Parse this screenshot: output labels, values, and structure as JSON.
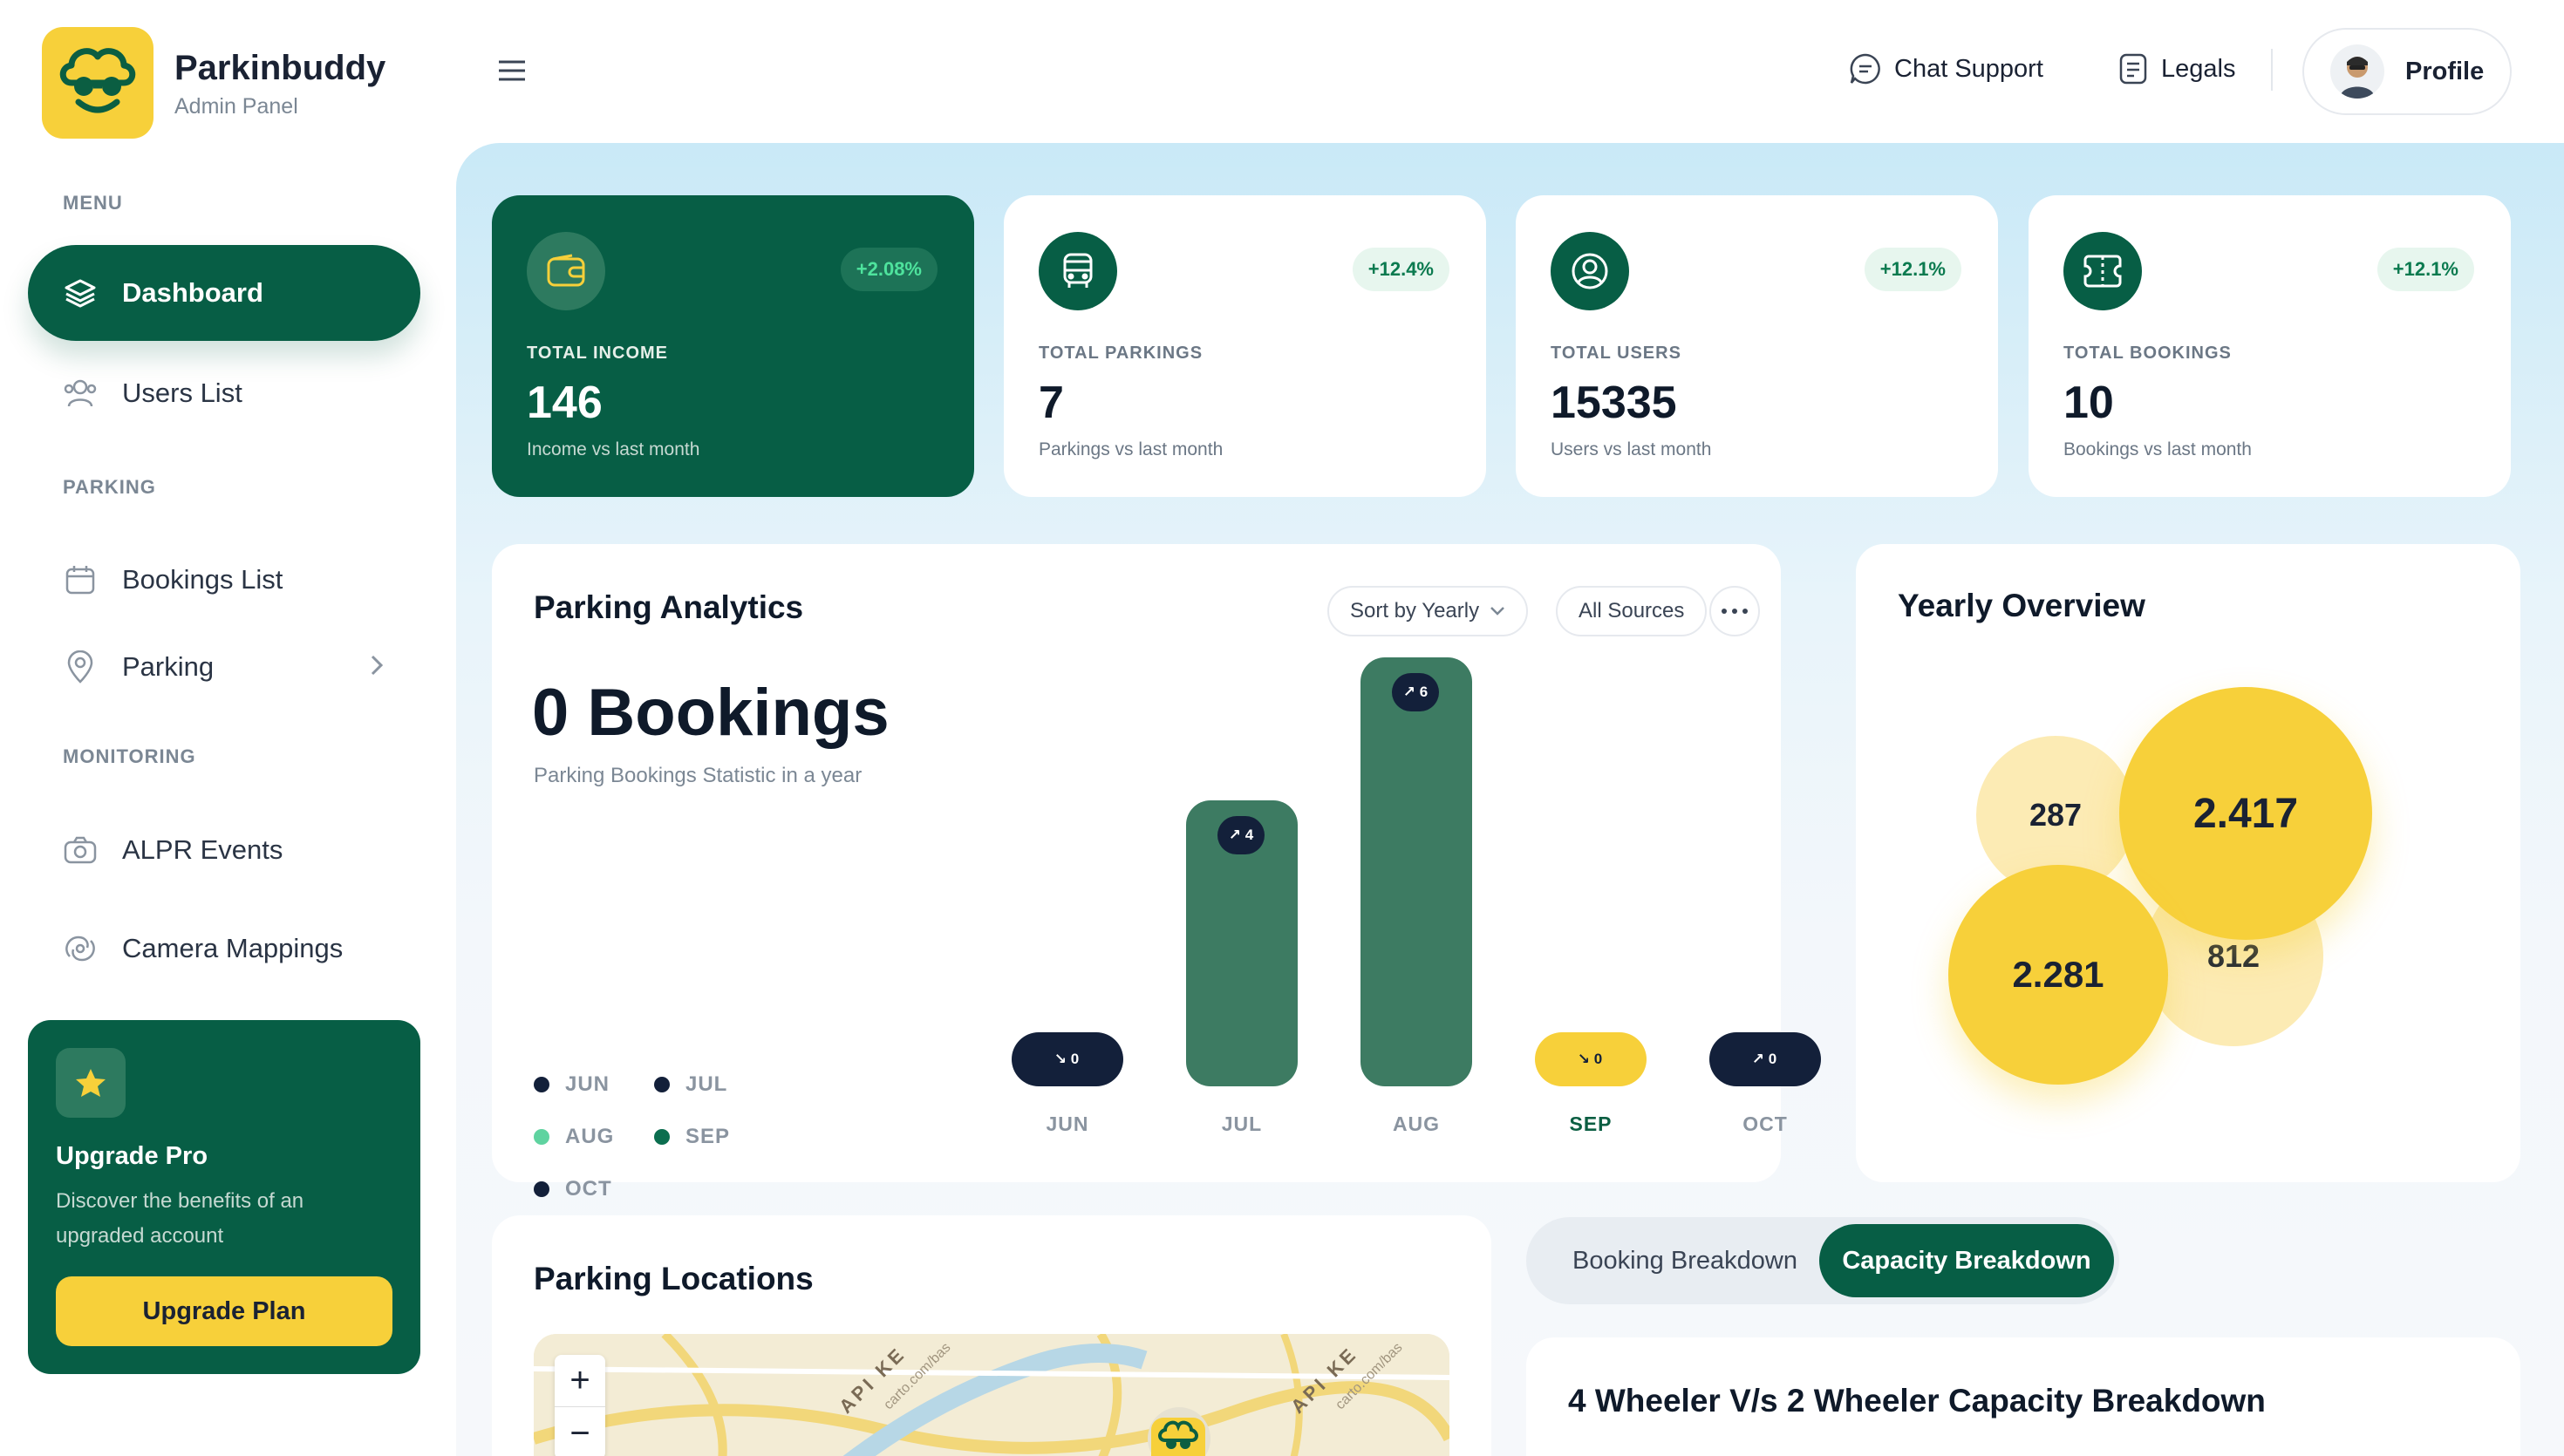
{
  "brand": {
    "name": "Parkinbuddy",
    "subtitle": "Admin Panel",
    "logo_color": "#f7d03a"
  },
  "sidebar": {
    "sections": {
      "menu": "MENU",
      "parking": "PARKING",
      "monitoring": "MONITORING"
    },
    "items": [
      {
        "label": "Dashboard",
        "icon": "layers-icon",
        "active": true
      },
      {
        "label": "Users List",
        "icon": "users-icon"
      },
      {
        "label": "Bookings List",
        "icon": "calendar-icon"
      },
      {
        "label": "Parking",
        "icon": "map-pin-icon",
        "has_submenu": true
      },
      {
        "label": "ALPR Events",
        "icon": "camera-icon"
      },
      {
        "label": "Camera Mappings",
        "icon": "camera-mapping-icon"
      }
    ],
    "upgrade": {
      "title": "Upgrade Pro",
      "description": "Discover the benefits of an upgraded account",
      "button": "Upgrade Plan"
    }
  },
  "header": {
    "chat_support": "Chat Support",
    "legals": "Legals",
    "profile": "Profile"
  },
  "stats": [
    {
      "label": "TOTAL INCOME",
      "value": "146",
      "sub": "Income vs last month",
      "change": "+2.08%",
      "icon": "wallet-icon"
    },
    {
      "label": "TOTAL PARKINGS",
      "value": "7",
      "sub": "Parkings vs last month",
      "change": "+12.4%",
      "icon": "bus-icon"
    },
    {
      "label": "TOTAL USERS",
      "value": "15335",
      "sub": "Users vs last month",
      "change": "+12.1%",
      "icon": "user-circle-icon"
    },
    {
      "label": "TOTAL BOOKINGS",
      "value": "10",
      "sub": "Bookings vs last month",
      "change": "+12.1%",
      "icon": "ticket-icon"
    }
  ],
  "analytics": {
    "title": "Parking Analytics",
    "sort_label": "Sort by Yearly",
    "source_label": "All Sources",
    "total": "0 Bookings",
    "subtitle": "Parking Bookings Statistic in a year",
    "legend": [
      {
        "label": "JUN",
        "color": "#13203a"
      },
      {
        "label": "JUL",
        "color": "#13203a"
      },
      {
        "label": "AUG",
        "color": "#5fd3a0"
      },
      {
        "label": "SEP",
        "color": "#0b6e4f"
      },
      {
        "label": "OCT",
        "color": "#13203a"
      }
    ]
  },
  "chart_data": {
    "type": "bar",
    "categories": [
      "JUN",
      "JUL",
      "AUG",
      "SEP",
      "OCT"
    ],
    "values": [
      0,
      4,
      6,
      0,
      0
    ],
    "badges": [
      "↘ 0",
      "↗ 4",
      "↗ 6",
      "↘ 0",
      "↗ 0"
    ],
    "highlighted": "SEP"
  },
  "yearly_overview": {
    "title": "Yearly Overview",
    "values": [
      "287",
      "2.417",
      "2.281",
      "812"
    ]
  },
  "locations": {
    "title": "Parking Locations",
    "zoom_in": "+",
    "zoom_out": "−",
    "watermark": "API KE",
    "attribution": "carto.com/bas"
  },
  "breakdown": {
    "tabs": [
      {
        "label": "Booking Breakdown",
        "active": false
      },
      {
        "label": "Capacity Breakdown",
        "active": true
      }
    ],
    "title": "4 Wheeler V/s 2 Wheeler Capacity Breakdown"
  }
}
